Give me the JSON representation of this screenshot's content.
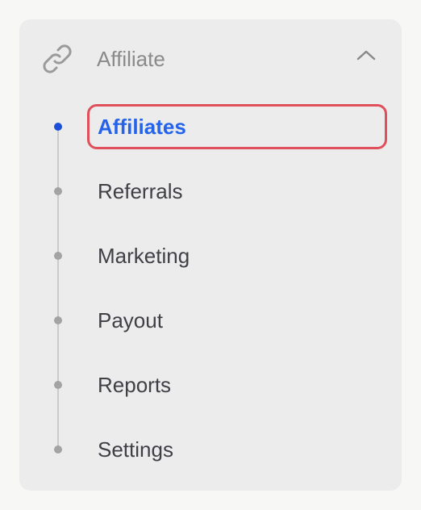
{
  "menu": {
    "title": "Affiliate",
    "icon": "link-icon",
    "expand_icon": "chevron-up-icon",
    "items": [
      {
        "label": "Affiliates",
        "active": true
      },
      {
        "label": "Referrals",
        "active": false
      },
      {
        "label": "Marketing",
        "active": false
      },
      {
        "label": "Payout",
        "active": false
      },
      {
        "label": "Reports",
        "active": false
      },
      {
        "label": "Settings",
        "active": false
      }
    ]
  },
  "colors": {
    "active_text": "#2563eb",
    "active_dot": "#1d4ed8",
    "highlight": "#e0505a",
    "panel_bg": "#ececec"
  }
}
